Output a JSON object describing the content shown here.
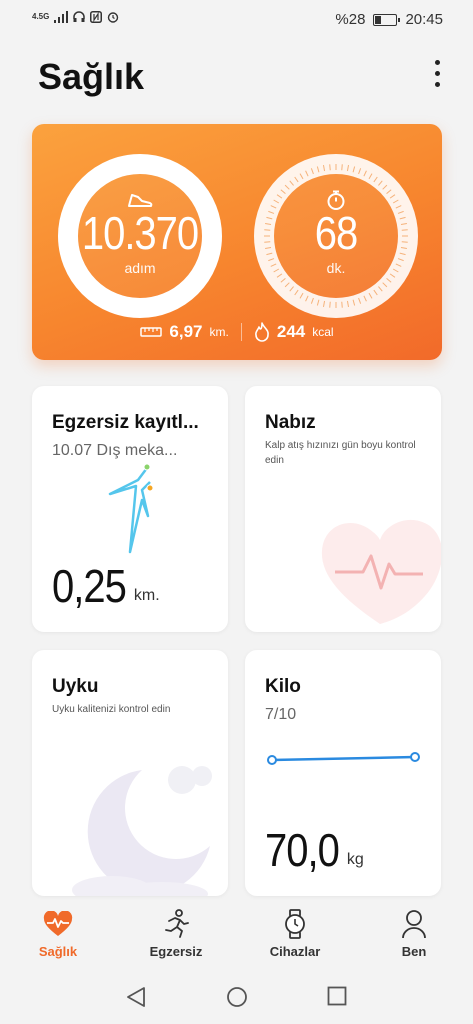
{
  "status": {
    "network": "4.5G",
    "battery_text": "%28",
    "battery_level": 0.28,
    "time": "20:45"
  },
  "header": {
    "title": "Sağlık",
    "menu_icon": "more-vert-icon"
  },
  "hero": {
    "steps_value": "10.370",
    "steps_unit": "adım",
    "steps_icon": "shoe-icon",
    "minutes_value": "68",
    "minutes_unit": "dk.",
    "minutes_icon": "stopwatch-icon",
    "distance_value": "6,97",
    "distance_unit": "km.",
    "calories_value": "244",
    "calories_unit": "kcal",
    "accent": "#f7852e"
  },
  "cards": {
    "exercise": {
      "title": "Egzersiz kayıtl...",
      "subtitle": "10.07 Dış meka...",
      "value": "0,25",
      "unit": "km."
    },
    "heart": {
      "title": "Nabız",
      "description": "Kalp atış hızınızı gün boyu kontrol edin"
    },
    "sleep": {
      "title": "Uyku",
      "description": "Uyku kalitenizi kontrol edin"
    },
    "weight": {
      "title": "Kilo",
      "subtitle": "7/10",
      "value": "70,0",
      "unit": "kg"
    }
  },
  "nav": {
    "items": [
      {
        "label": "Sağlık",
        "icon": "heart-pulse-icon",
        "active": true
      },
      {
        "label": "Egzersiz",
        "icon": "runner-icon",
        "active": false
      },
      {
        "label": "Cihazlar",
        "icon": "watch-icon",
        "active": false
      },
      {
        "label": "Ben",
        "icon": "person-icon",
        "active": false
      }
    ]
  },
  "colors": {
    "active": "#f06a2a",
    "route": "#4fc3e8",
    "weight_line": "#2a8ae0"
  }
}
